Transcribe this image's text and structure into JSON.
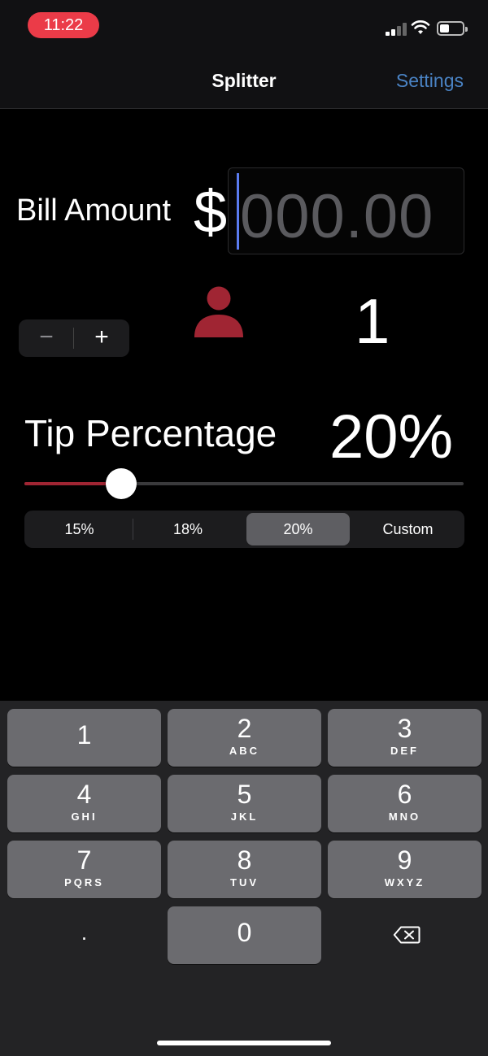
{
  "status_bar": {
    "time": "11:22"
  },
  "nav": {
    "title": "Splitter",
    "settings_label": "Settings"
  },
  "bill": {
    "label": "Bill Amount",
    "currency_symbol": "$",
    "placeholder": "000.00",
    "value": ""
  },
  "people": {
    "decrement_label": "−",
    "increment_label": "+",
    "count": "1",
    "icon": "person-icon"
  },
  "tip": {
    "label": "Tip Percentage",
    "value_display": "20%",
    "slider_fraction": 0.22,
    "options": [
      "15%",
      "18%",
      "20%",
      "Custom"
    ],
    "selected_index": 2
  },
  "keyboard": {
    "keys": [
      {
        "digit": "1",
        "letters": ""
      },
      {
        "digit": "2",
        "letters": "ABC"
      },
      {
        "digit": "3",
        "letters": "DEF"
      },
      {
        "digit": "4",
        "letters": "GHI"
      },
      {
        "digit": "5",
        "letters": "JKL"
      },
      {
        "digit": "6",
        "letters": "MNO"
      },
      {
        "digit": "7",
        "letters": "PQRS"
      },
      {
        "digit": "8",
        "letters": "TUV"
      },
      {
        "digit": "9",
        "letters": "WXYZ"
      },
      {
        "digit": ".",
        "letters": ""
      },
      {
        "digit": "0",
        "letters": ""
      },
      {
        "digit": "",
        "letters": "",
        "icon": "backspace-icon"
      }
    ]
  },
  "colors": {
    "accent_red": "#a02533",
    "status_red": "#eb3b48",
    "link_blue": "#4a83c4",
    "caret_blue": "#5b7cf0"
  }
}
